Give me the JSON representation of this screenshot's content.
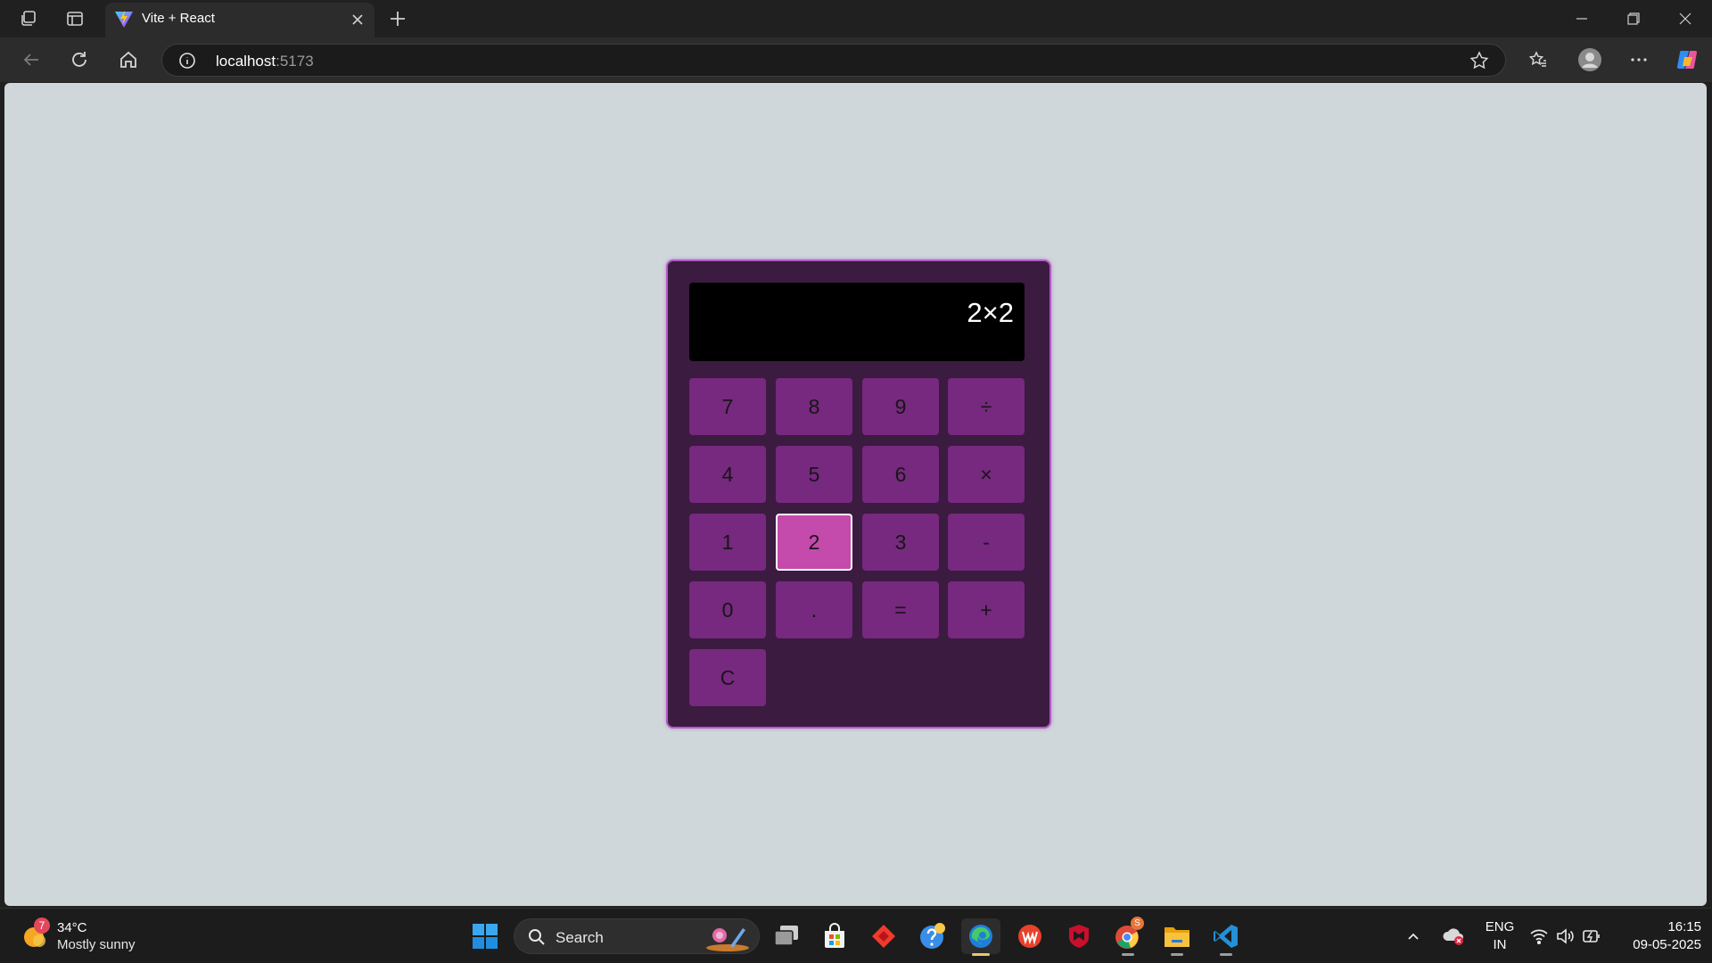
{
  "browser": {
    "tab_title": "Vite + React",
    "url_host": "localhost",
    "url_port": ":5173"
  },
  "calculator": {
    "display": "2×2",
    "keys": [
      "7",
      "8",
      "9",
      "÷",
      "4",
      "5",
      "6",
      "×",
      "1",
      "2",
      "3",
      "-",
      "0",
      ".",
      "=",
      "+",
      "C"
    ],
    "active_key": "2",
    "colors": {
      "key": "#77287f",
      "key_active": "#c44aac",
      "body": "#3b1b40",
      "border": "#b25ac6",
      "page_background": "#cfd7da"
    }
  },
  "taskbar": {
    "weather_badge": "7",
    "weather_temp": "34°C",
    "weather_desc": "Mostly sunny",
    "search_label": "Search",
    "language": "ENG",
    "region": "IN",
    "time": "16:15",
    "date": "09-05-2025",
    "chrome_badge": "S"
  }
}
